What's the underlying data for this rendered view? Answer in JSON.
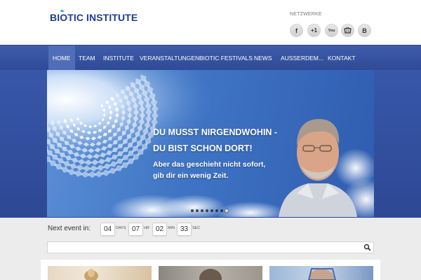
{
  "header": {
    "logo_text": "BIOTIC INSTITUTE",
    "networks_label": "NETZWERKE",
    "social": [
      {
        "icon": "facebook-icon",
        "glyph": "f"
      },
      {
        "icon": "googleplus-icon",
        "glyph": "+1"
      },
      {
        "icon": "youtube-icon",
        "glyph": "You"
      },
      {
        "icon": "shop-icon",
        "glyph": ""
      },
      {
        "icon": "blog-icon",
        "glyph": "B"
      }
    ]
  },
  "nav": {
    "items": [
      "HOME",
      "TEAM",
      "INSTITUTE",
      "VERANSTALTUNGEN",
      "BIOTIC FESTIVALS",
      "NEWS",
      "AUSSERDEM...",
      "KONTAKT"
    ],
    "active": "HOME"
  },
  "slider": {
    "headline_1": "DU MUSST NIRGENDWOHIN -",
    "headline_2": "DU BIST SCHON DORT!",
    "sub_1": "Aber das geschieht nicht sofort,",
    "sub_2": "gib dir ein wenig Zeit.",
    "slide_count": 8,
    "active_slide": 8
  },
  "countdown": {
    "label": "Next event in:",
    "days": "04",
    "days_unit": "DAYS",
    "hours": "07",
    "hours_unit": "HR",
    "minutes": "02",
    "minutes_unit": "MIN",
    "seconds": "33",
    "seconds_unit": "SEC"
  },
  "search": {
    "placeholder": "",
    "value": ""
  },
  "colors": {
    "brand": "#1f3d91",
    "nav": "#34509c",
    "accent": "#4aa3e0"
  }
}
